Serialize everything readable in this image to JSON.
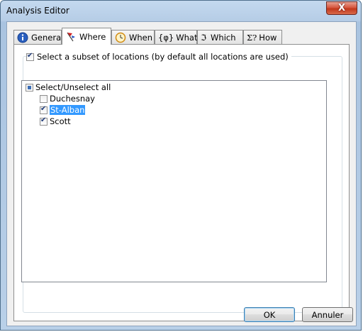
{
  "window": {
    "title": "Analysis Editor",
    "close_glyph": "X"
  },
  "tabs": [
    {
      "label": "General",
      "icon": "info-icon",
      "active": false
    },
    {
      "label": "Where",
      "icon": "flag-pin-icon",
      "active": true
    },
    {
      "label": "When",
      "icon": "clock-icon",
      "active": false
    },
    {
      "label": "What",
      "icon_text": "{φ}",
      "active": false
    },
    {
      "label": "Which",
      "icon_text": "ℑ",
      "active": false
    },
    {
      "label": "How",
      "icon_text": "Σ?",
      "active": false
    }
  ],
  "where": {
    "subset_label": "Select a subset of locations (by default all locations are used)",
    "subset_checked": true,
    "tree": {
      "root_label": "Select/Unselect all",
      "root_state": "partial",
      "items": [
        {
          "label": "Duchesnay",
          "checked": false,
          "selected": false
        },
        {
          "label": "St-Alban",
          "checked": true,
          "selected": true
        },
        {
          "label": "Scott",
          "checked": true,
          "selected": false
        }
      ]
    }
  },
  "buttons": {
    "ok": "OK",
    "cancel": "Annuler"
  },
  "colors": {
    "selection": "#3399ff",
    "close_button": "#c2381c",
    "title_bar": "#b6cde6"
  }
}
